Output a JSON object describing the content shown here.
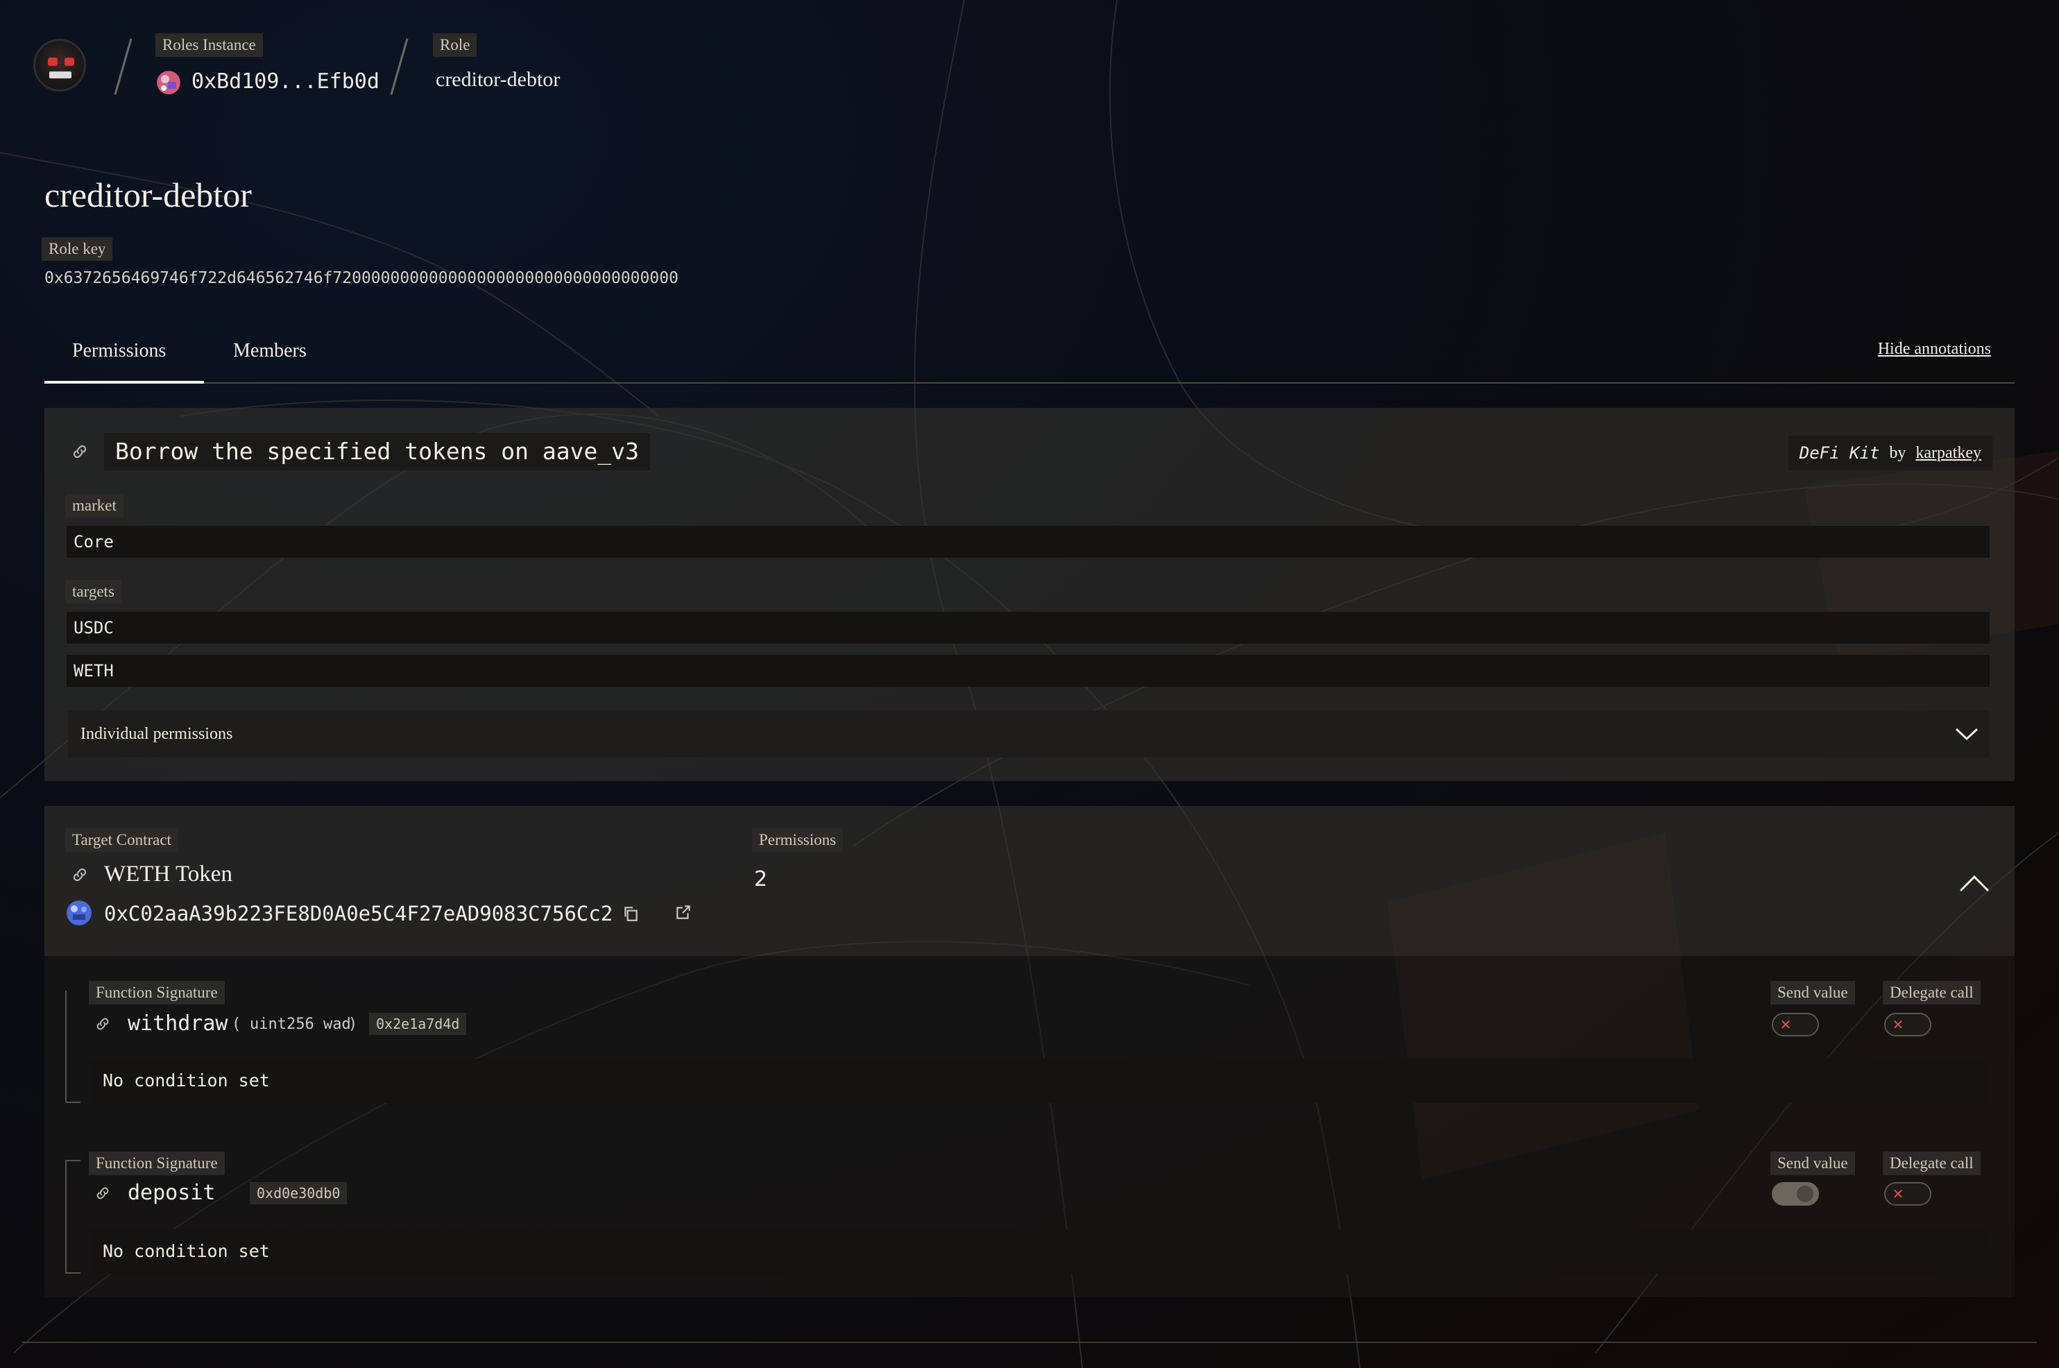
{
  "breadcrumb": {
    "instance_label": "Roles Instance",
    "instance_value": "0xBd109...Efb0d",
    "role_label": "Role",
    "role_value": "creditor-debtor"
  },
  "page": {
    "title": "creditor-debtor",
    "role_key_label": "Role key",
    "role_key_value": "0x6372656469746f722d646562746f720000000000000000000000000000000000"
  },
  "tabs": {
    "permissions": "Permissions",
    "members": "Members",
    "active": "Permissions",
    "hide_annotations": "Hide annotations"
  },
  "annotation": {
    "title": "Borrow the specified tokens on aave_v3",
    "kit_name": "DeFi Kit",
    "by_label": "by",
    "author": "karpatkey",
    "params": {
      "market_label": "market",
      "market_value": "Core",
      "targets_label": "targets",
      "targets": [
        "USDC",
        "WETH"
      ]
    },
    "individual_permissions": "Individual permissions"
  },
  "target": {
    "label": "Target Contract",
    "name": "WETH Token",
    "address": "0xC02aaA39b223FE8D0A0e5C4F27eAD9083C756Cc2",
    "permissions_label": "Permissions",
    "permissions_count": "2"
  },
  "functions": [
    {
      "sig_label": "Function Signature",
      "name": "withdraw",
      "open_paren": "(",
      "params": "uint256 wad",
      "close_paren": ")",
      "selector": "0x2e1a7d4d",
      "send_value_label": "Send value",
      "send_value": false,
      "delegate_call_label": "Delegate call",
      "delegate_call": false,
      "condition": "No condition set"
    },
    {
      "sig_label": "Function Signature",
      "name": "deposit",
      "selector": "0xd0e30db0",
      "send_value_label": "Send value",
      "send_value": true,
      "delegate_call_label": "Delegate call",
      "delegate_call": false,
      "condition": "No condition set"
    }
  ],
  "colors": {
    "panel": "#34322b",
    "field": "#141311",
    "toggle_off_x": "#e05050"
  }
}
